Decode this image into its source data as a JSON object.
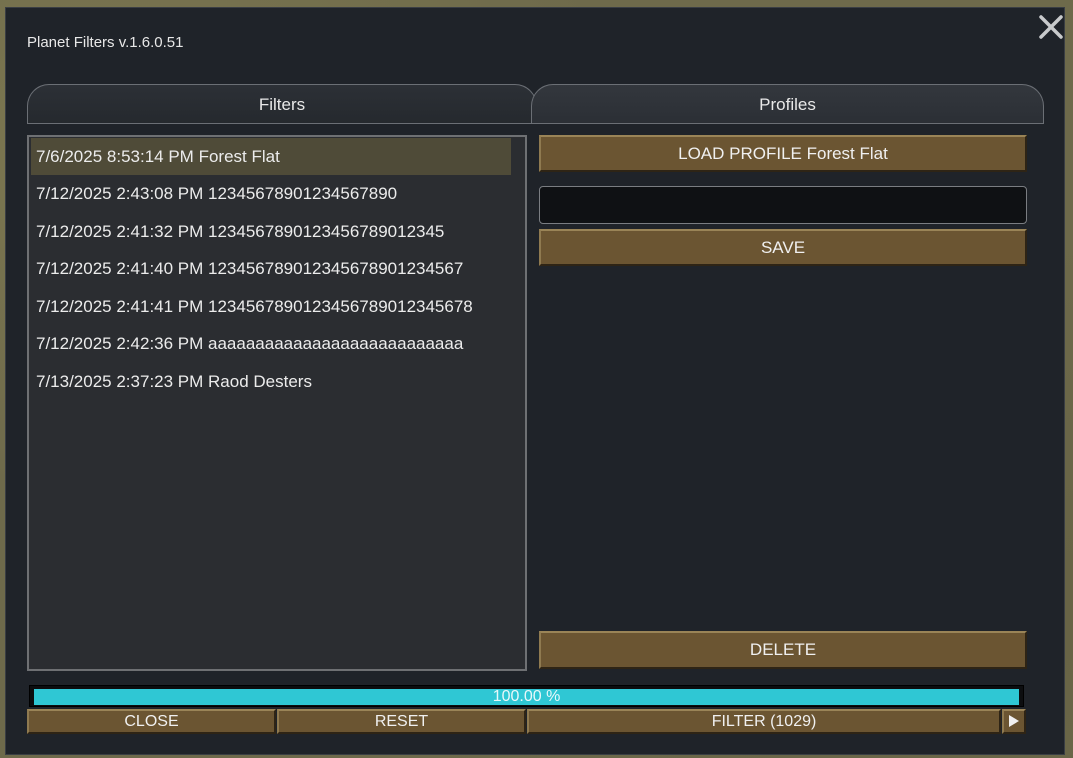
{
  "window": {
    "title": "Planet Filters v.1.6.0.51"
  },
  "tabs": [
    {
      "label": "Filters"
    },
    {
      "label": "Profiles"
    }
  ],
  "profiles": {
    "items": [
      {
        "label": "7/6/2025 8:53:14 PM Forest Flat",
        "selected": true
      },
      {
        "label": "7/12/2025 2:43:08 PM 12345678901234567890"
      },
      {
        "label": "7/12/2025 2:41:32 PM 1234567890123456789012345"
      },
      {
        "label": "7/12/2025 2:41:40 PM 12345678901234567890123456​7"
      },
      {
        "label": "7/12/2025 2:41:41 PM 1234567890123456789012345678"
      },
      {
        "label": "7/12/2025 2:42:36 PM aaaaaaaaaaaaaaaaaaaaaaaaaaa"
      },
      {
        "label": "7/13/2025 2:37:23 PM Raod Desters"
      }
    ],
    "load_label": "LOAD PROFILE Forest Flat",
    "name_value": "",
    "save_label": "SAVE",
    "delete_label": "DELETE"
  },
  "progress": {
    "value": 1.0,
    "label": "100.00 %"
  },
  "footer": {
    "close_label": "CLOSE",
    "reset_label": "RESET",
    "filter_label": "FILTER (1029)"
  },
  "colors": {
    "window_bg": "#1f2329",
    "button": "#6b5532",
    "progress": "#2fc7d4",
    "selected_row": "#4f4b38"
  },
  "icons": {
    "close": "close-icon",
    "arrow": "play-arrow-icon"
  }
}
